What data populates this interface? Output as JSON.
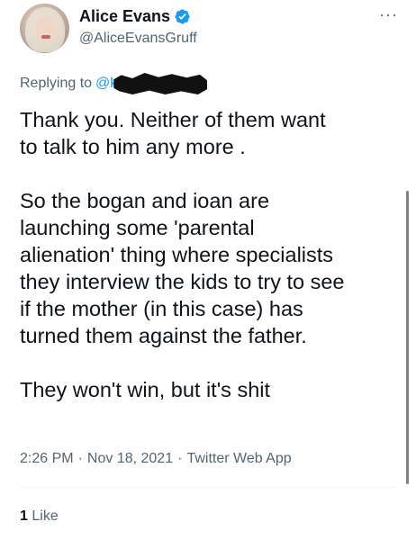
{
  "author": {
    "display_name": "Alice Evans",
    "handle": "@AliceEvansGruff",
    "verified": true
  },
  "more_label": "···",
  "reply": {
    "prefix": "Replying to",
    "mention_visible": "@k"
  },
  "tweet": {
    "paragraphs": [
      "Thank you. Neither of them want\nto talk to him any more .",
      "So the bogan and ioan are\nlaunching some 'parental\nalienation' thing where specialists\nthey interview the kids to try to see\nif the mother (in this case) has\nturned them against the father.",
      "They won't win, but it's shit"
    ]
  },
  "meta": {
    "time": "2:26 PM",
    "separator": "·",
    "date": "Nov 18, 2021",
    "source": "Twitter Web App"
  },
  "likes": {
    "count": "1",
    "label": "Like"
  },
  "colors": {
    "accent": "#1d9bf0",
    "text": "#0f1419",
    "secondary": "#536471"
  }
}
